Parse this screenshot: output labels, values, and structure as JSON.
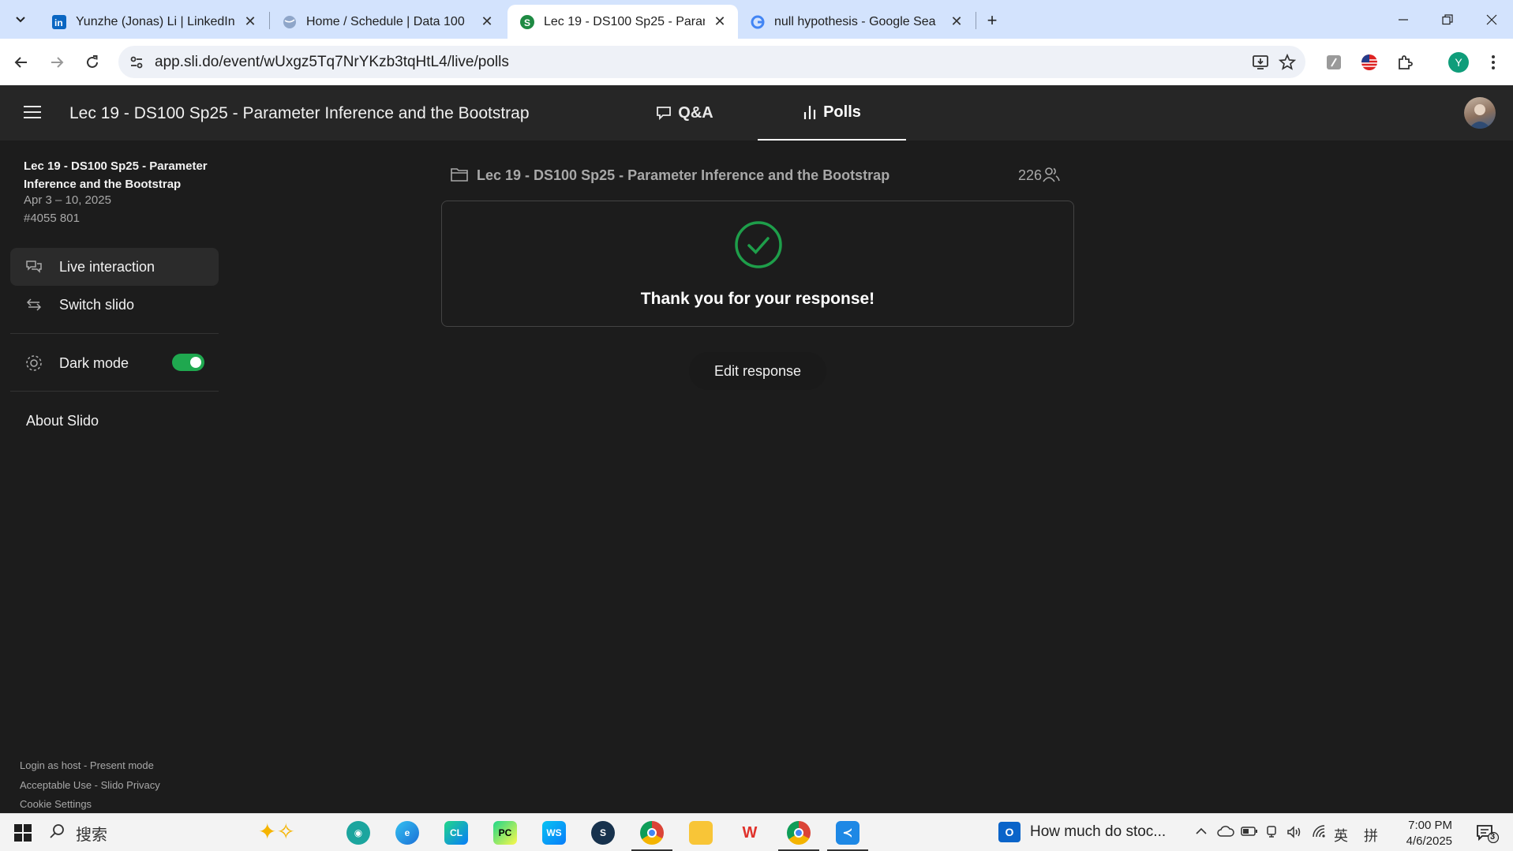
{
  "browser": {
    "tabs": [
      {
        "title": "Yunzhe (Jonas) Li | LinkedIn",
        "favicon": "linkedin-icon",
        "active": false
      },
      {
        "title": "Home / Schedule | Data 100",
        "favicon": "globe-icon",
        "active": false
      },
      {
        "title": "Lec 19 - DS100 Sp25 - Param",
        "favicon": "slido-icon",
        "active": true
      },
      {
        "title": "null hypothesis - Google Sea",
        "favicon": "google-icon",
        "active": false
      }
    ],
    "url": "app.sli.do/event/wUxgz5Tq7NrYKzb3tqHtL4/live/polls",
    "profile_initial": "Y"
  },
  "app": {
    "title": "Lec 19 - DS100 Sp25 - Parameter Inference and the Bootstrap",
    "nav_tabs": [
      {
        "label": "Q&A",
        "icon": "chat-bubble-icon",
        "active": false
      },
      {
        "label": "Polls",
        "icon": "bar-chart-icon",
        "active": true
      }
    ]
  },
  "sidebar": {
    "event_title": "Lec 19 - DS100 Sp25 - Parameter Inference and the Bootstrap",
    "event_dates": "Apr 3 – 10, 2025",
    "event_code": "#4055 801",
    "items": [
      {
        "label": "Live interaction",
        "icon": "chat-bubbles-icon",
        "selected": true
      },
      {
        "label": "Switch slido",
        "icon": "switch-arrows-icon",
        "selected": false
      }
    ],
    "dark_mode_label": "Dark mode",
    "dark_mode_on": true,
    "about_label": "About Slido",
    "footer": {
      "login_host": "Login as host",
      "present_mode": "Present mode",
      "acceptable_use": "Acceptable Use",
      "privacy": "Slido Privacy",
      "cookie": "Cookie Settings",
      "separator": " - "
    }
  },
  "main": {
    "event_name": "Lec 19 - DS100 Sp25 - Parameter Inference and the Bootstrap",
    "participant_count": "226",
    "confirmation": "Thank you for your response!",
    "edit_button": "Edit response"
  },
  "taskbar": {
    "search_label": "搜索",
    "news_text": "How much do stoc...",
    "ime_lang": "英",
    "ime_mode": "拼",
    "time": "7:00 PM",
    "date": "4/6/2025",
    "notification_count": "3"
  },
  "colors": {
    "accent_green": "#1fa84f",
    "check_green": "#1e9e4a",
    "app_bg": "#1c1c1c",
    "header_bg": "#262626"
  }
}
